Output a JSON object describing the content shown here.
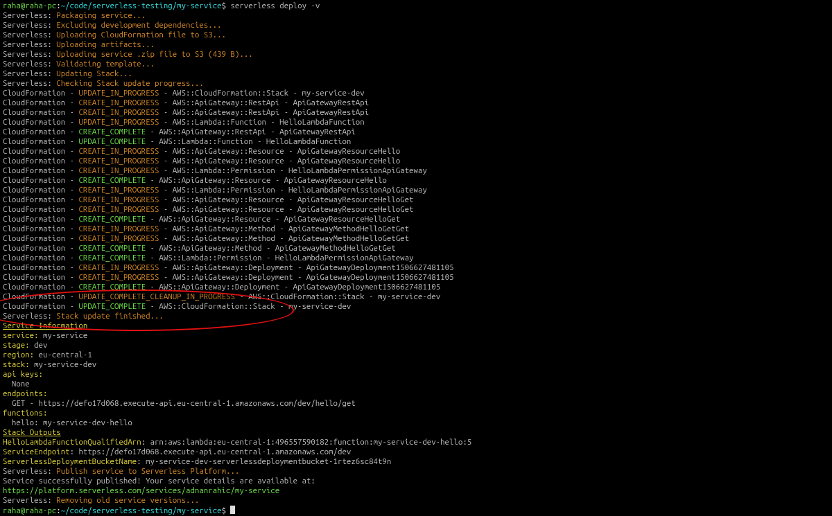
{
  "prompt": {
    "userhost": "raha@raha-pc",
    "colon": ":",
    "path": "~/code/serverless-testing/my-service",
    "dollar": "$ ",
    "cmd": "serverless deploy -v"
  },
  "sls": [
    "Packaging service...",
    "Excluding development dependencies...",
    "Uploading CloudFormation file to S3...",
    "Uploading artifacts...",
    "Uploading service .zip file to S3 (439 B)...",
    "Validating template...",
    "Updating Stack...",
    "Checking Stack update progress..."
  ],
  "cf": [
    {
      "status": "UPDATE_IN_PROGRESS",
      "res": "AWS::CloudFormation::Stack - my-service-dev"
    },
    {
      "status": "CREATE_IN_PROGRESS",
      "res": "AWS::ApiGateway::RestApi - ApiGatewayRestApi"
    },
    {
      "status": "CREATE_IN_PROGRESS",
      "res": "AWS::ApiGateway::RestApi - ApiGatewayRestApi"
    },
    {
      "status": "UPDATE_IN_PROGRESS",
      "res": "AWS::Lambda::Function - HelloLambdaFunction"
    },
    {
      "status": "CREATE_COMPLETE",
      "res": "AWS::ApiGateway::RestApi - ApiGatewayRestApi"
    },
    {
      "status": "UPDATE_COMPLETE",
      "res": "AWS::Lambda::Function - HelloLambdaFunction"
    },
    {
      "status": "CREATE_IN_PROGRESS",
      "res": "AWS::ApiGateway::Resource - ApiGatewayResourceHello"
    },
    {
      "status": "CREATE_IN_PROGRESS",
      "res": "AWS::ApiGateway::Resource - ApiGatewayResourceHello"
    },
    {
      "status": "CREATE_IN_PROGRESS",
      "res": "AWS::Lambda::Permission - HelloLambdaPermissionApiGateway"
    },
    {
      "status": "CREATE_COMPLETE",
      "res": "AWS::ApiGateway::Resource - ApiGatewayResourceHello"
    },
    {
      "status": "CREATE_IN_PROGRESS",
      "res": "AWS::Lambda::Permission - HelloLambdaPermissionApiGateway"
    },
    {
      "status": "CREATE_IN_PROGRESS",
      "res": "AWS::ApiGateway::Resource - ApiGatewayResourceHelloGet"
    },
    {
      "status": "CREATE_IN_PROGRESS",
      "res": "AWS::ApiGateway::Resource - ApiGatewayResourceHelloGet"
    },
    {
      "status": "CREATE_COMPLETE",
      "res": "AWS::ApiGateway::Resource - ApiGatewayResourceHelloGet"
    },
    {
      "status": "CREATE_IN_PROGRESS",
      "res": "AWS::ApiGateway::Method - ApiGatewayMethodHelloGetGet"
    },
    {
      "status": "CREATE_IN_PROGRESS",
      "res": "AWS::ApiGateway::Method - ApiGatewayMethodHelloGetGet"
    },
    {
      "status": "CREATE_COMPLETE",
      "res": "AWS::ApiGateway::Method - ApiGatewayMethodHelloGetGet"
    },
    {
      "status": "CREATE_COMPLETE",
      "res": "AWS::Lambda::Permission - HelloLambdaPermissionApiGateway"
    },
    {
      "status": "CREATE_IN_PROGRESS",
      "res": "AWS::ApiGateway::Deployment - ApiGatewayDeployment1506627481105"
    },
    {
      "status": "CREATE_IN_PROGRESS",
      "res": "AWS::ApiGateway::Deployment - ApiGatewayDeployment1506627481105"
    },
    {
      "status": "CREATE_COMPLETE",
      "res": "AWS::ApiGateway::Deployment - ApiGatewayDeployment1506627481105"
    },
    {
      "status": "UPDATE_COMPLETE_CLEANUP_IN_PROGRESS",
      "res": "AWS::CloudFormation::Stack - my-service-dev"
    },
    {
      "status": "UPDATE_COMPLETE",
      "res": "AWS::CloudFormation::Stack - my-service-dev"
    }
  ],
  "finished": "Stack update finished...",
  "info": {
    "header": "Service Information",
    "service_key": "service:",
    "service_val": " my-service",
    "stage_key": "stage:",
    "stage_val": " dev",
    "region_key": "region:",
    "region_val": " eu-central-1",
    "stack_key": "stack:",
    "stack_val": " my-service-dev",
    "apikeys_key": "api keys:",
    "apikeys_val": "  None",
    "endpoints_key": "endpoints:",
    "endpoint_line": "  GET - https://defo17d068.execute-api.eu-central-1.amazonaws.com/dev/hello/get",
    "functions_key": "functions:",
    "functions_val": "  hello: my-service-dev-hello"
  },
  "stack_out": {
    "header": "Stack Outputs",
    "r1k": "HelloLambdaFunctionQualifiedArn",
    "r1v": ": arn:aws:lambda:eu-central-1:496557590182:function:my-service-dev-hello:5",
    "r2k": "ServiceEndpoint",
    "r2v": ": https://defo17d068.execute-api.eu-central-1.amazonaws.com/dev",
    "r3k": "ServerlessDeploymentBucketName",
    "r3v": ": my-service-dev-serverlessdeploymentbucket-1rtez6sc84t9n"
  },
  "tail": {
    "publish": "Publish service to Serverless Platform...",
    "success": "Service successfully published! Your service details are available at:",
    "url": "https://platform.serverless.com/services/adnanrahic/my-service",
    "removing": "Removing old service versions..."
  },
  "label_sls": "Serverless: ",
  "label_cf": "CloudFormation - "
}
